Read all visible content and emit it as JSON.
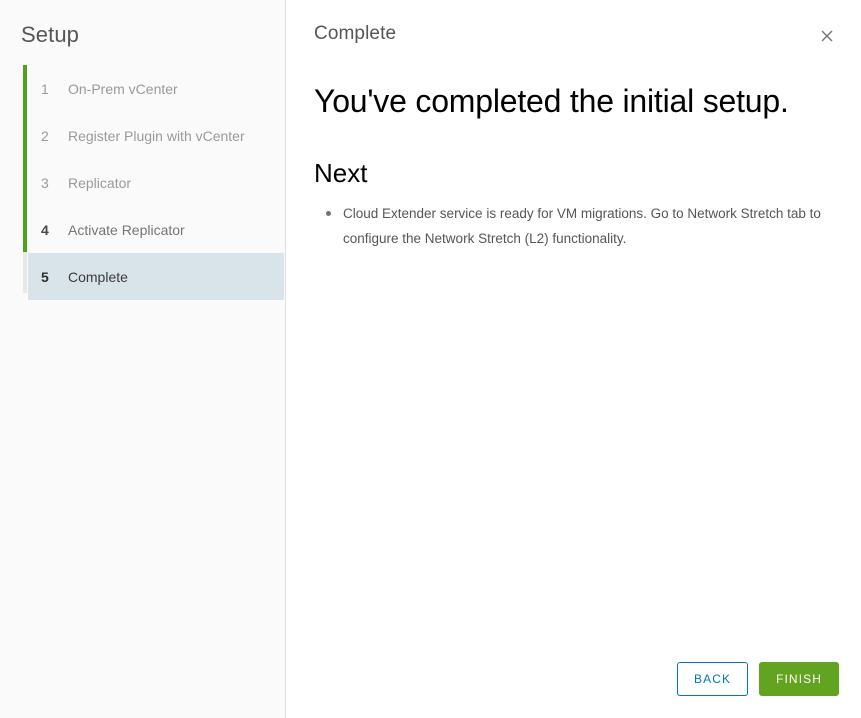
{
  "sidebar": {
    "title": "Setup",
    "steps": [
      {
        "num": "1",
        "label": "On-Prem vCenter",
        "state": "done"
      },
      {
        "num": "2",
        "label": "Register Plugin with vCenter",
        "state": "done"
      },
      {
        "num": "3",
        "label": "Replicator",
        "state": "done"
      },
      {
        "num": "4",
        "label": "Activate Replicator",
        "state": "done-bold"
      },
      {
        "num": "5",
        "label": "Complete",
        "state": "active"
      }
    ]
  },
  "content": {
    "subtitle": "Complete",
    "close_icon": "close-icon",
    "main_title": "You've completed the initial setup.",
    "section_title": "Next",
    "bullets": [
      "Cloud Extender service is ready for VM migrations. Go to Network Stretch tab to configure the Network Stretch (L2) functionality."
    ]
  },
  "footer": {
    "back_label": "BACK",
    "finish_label": "FINISH"
  },
  "colors": {
    "progress_green": "#4fa01a",
    "primary_green": "#62a420",
    "link_blue": "#0079b8",
    "active_step_bg": "#d9e4ea",
    "sidebar_bg": "#fafafa"
  }
}
